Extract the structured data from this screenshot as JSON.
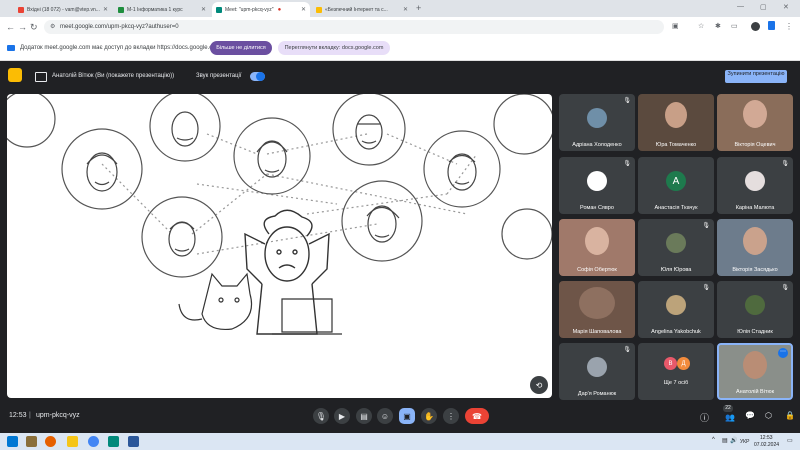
{
  "browser": {
    "tabs": [
      {
        "title": "Вхідні (18 072) - vam@vtep.vn...",
        "active": false
      },
      {
        "title": "M-1 Інформатика 1 курс",
        "active": false
      },
      {
        "title": "Meet: \"upm-pkcq-vyz\"",
        "active": true
      },
      {
        "title": "«Безпечний Інтернет та с...",
        "active": false
      }
    ],
    "url": "meet.google.com/upm-pkcq-vyz?authuser=0",
    "infobar_text": "Додаток meet.google.com має доступ до вкладки https://docs.google.com",
    "stop_sharing_label": "Більше не ділитися",
    "switch_tab_label": "Переглянути вкладку: docs.google.com"
  },
  "presenting": {
    "presenter_label": "Анатолій Вітюк (Ви (покажете презентацію))",
    "sound_label": "Звук презентації",
    "stop_button_label": "Зупинити презентацію"
  },
  "participants": [
    {
      "name": "Адріана Холоденко",
      "type": "photo",
      "color": "#6f8fa8"
    },
    {
      "name": "Юра Томаченко",
      "type": "video",
      "color": "#5b4a3e"
    },
    {
      "name": "Вікторія Оцевич",
      "type": "video",
      "color": "#8a6d5a"
    },
    {
      "name": "Роман Сявро",
      "type": "photo",
      "color": "#ffffff"
    },
    {
      "name": "Анастасія Ткачук",
      "type": "letter",
      "letter": "A",
      "color": "#1e7a4d"
    },
    {
      "name": "Каріна Малюта",
      "type": "photo",
      "color": "#e5dede"
    },
    {
      "name": "Софія Обертюк",
      "type": "video",
      "color": "#a0796a"
    },
    {
      "name": "Юля Юрова",
      "type": "photo",
      "color": "#6a7a5a"
    },
    {
      "name": "Вікторія Засядько",
      "type": "video",
      "color": "#6d7c8c"
    },
    {
      "name": "Марія Шаповалова",
      "type": "video",
      "color": "#6e5548"
    },
    {
      "name": "Angelina Yakobchuk",
      "type": "photo",
      "color": "#bca37a"
    },
    {
      "name": "Юлія Стадник",
      "type": "photo",
      "color": "#4f6a3e"
    },
    {
      "name": "Дар'я Романюк",
      "type": "photo",
      "color": "#9aa3ad"
    },
    {
      "name": "Ще 7 осіб",
      "type": "more",
      "letters": [
        "В",
        "Д"
      ]
    },
    {
      "name": "Анатолій Вітюк",
      "type": "video",
      "color": "#8a8f8a"
    }
  ],
  "bottom": {
    "time": "12:53",
    "meeting_code": "upm-pkcq-vyz",
    "participants_count": "22"
  },
  "taskbar": {
    "lang": "УКР",
    "clock_time": "12:53",
    "clock_date": "07.02.2024"
  }
}
